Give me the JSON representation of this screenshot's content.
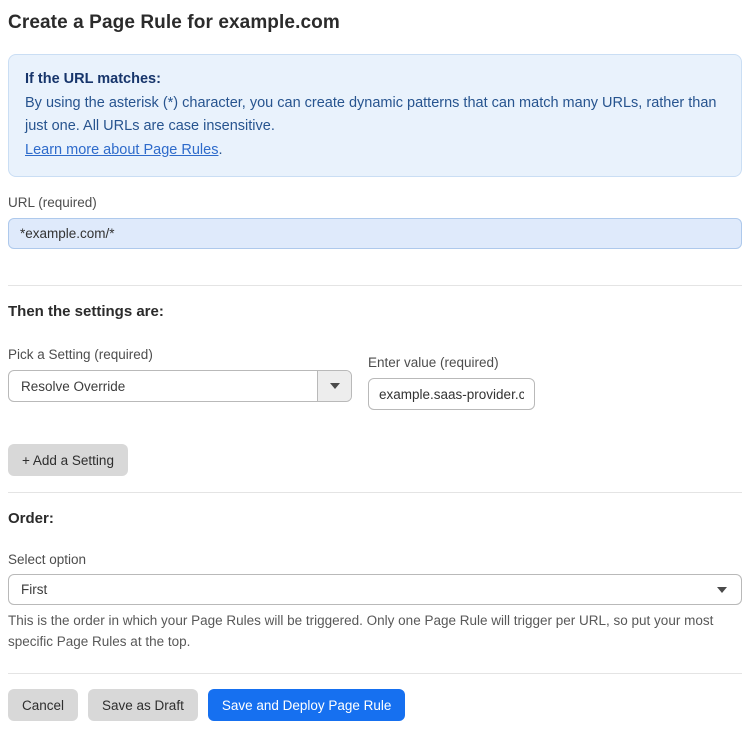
{
  "page": {
    "title": "Create a Page Rule for example.com"
  },
  "info_box": {
    "heading": "If the URL matches:",
    "body": "By using the asterisk (*) character, you can create dynamic patterns that can match many URLs, rather than just one. All URLs are case insensitive.",
    "link_text": "Learn more about Page Rules",
    "link_suffix": "."
  },
  "url_field": {
    "label": "URL (required)",
    "value": "*example.com/*"
  },
  "settings_section": {
    "heading": "Then the settings are:",
    "setting_select": {
      "label": "Pick a Setting (required)",
      "value": "Resolve Override"
    },
    "value_input": {
      "label": "Enter value (required)",
      "value": "example.saas-provider.c"
    },
    "add_button_label": "+ Add a Setting"
  },
  "order_section": {
    "heading": "Order:",
    "select_label": "Select option",
    "select_value": "First",
    "help_text": "This is the order in which your Page Rules will be triggered. Only one Page Rule will trigger per URL, so put your most specific Page Rules at the top."
  },
  "footer": {
    "cancel_label": "Cancel",
    "save_draft_label": "Save as Draft",
    "save_deploy_label": "Save and Deploy Page Rule"
  },
  "colors": {
    "accent_blue": "#1670f0",
    "info_box_bg": "#e9f2fc",
    "info_box_border": "#cadef4",
    "info_heading_text": "#17356b",
    "info_body_text": "#27548f",
    "link_blue": "#2e6bcb",
    "url_input_bg": "#dfeafb",
    "url_input_border": "#aec9ec",
    "gray_button_bg": "#d8d8d8",
    "divider": "#e4e4e4"
  }
}
